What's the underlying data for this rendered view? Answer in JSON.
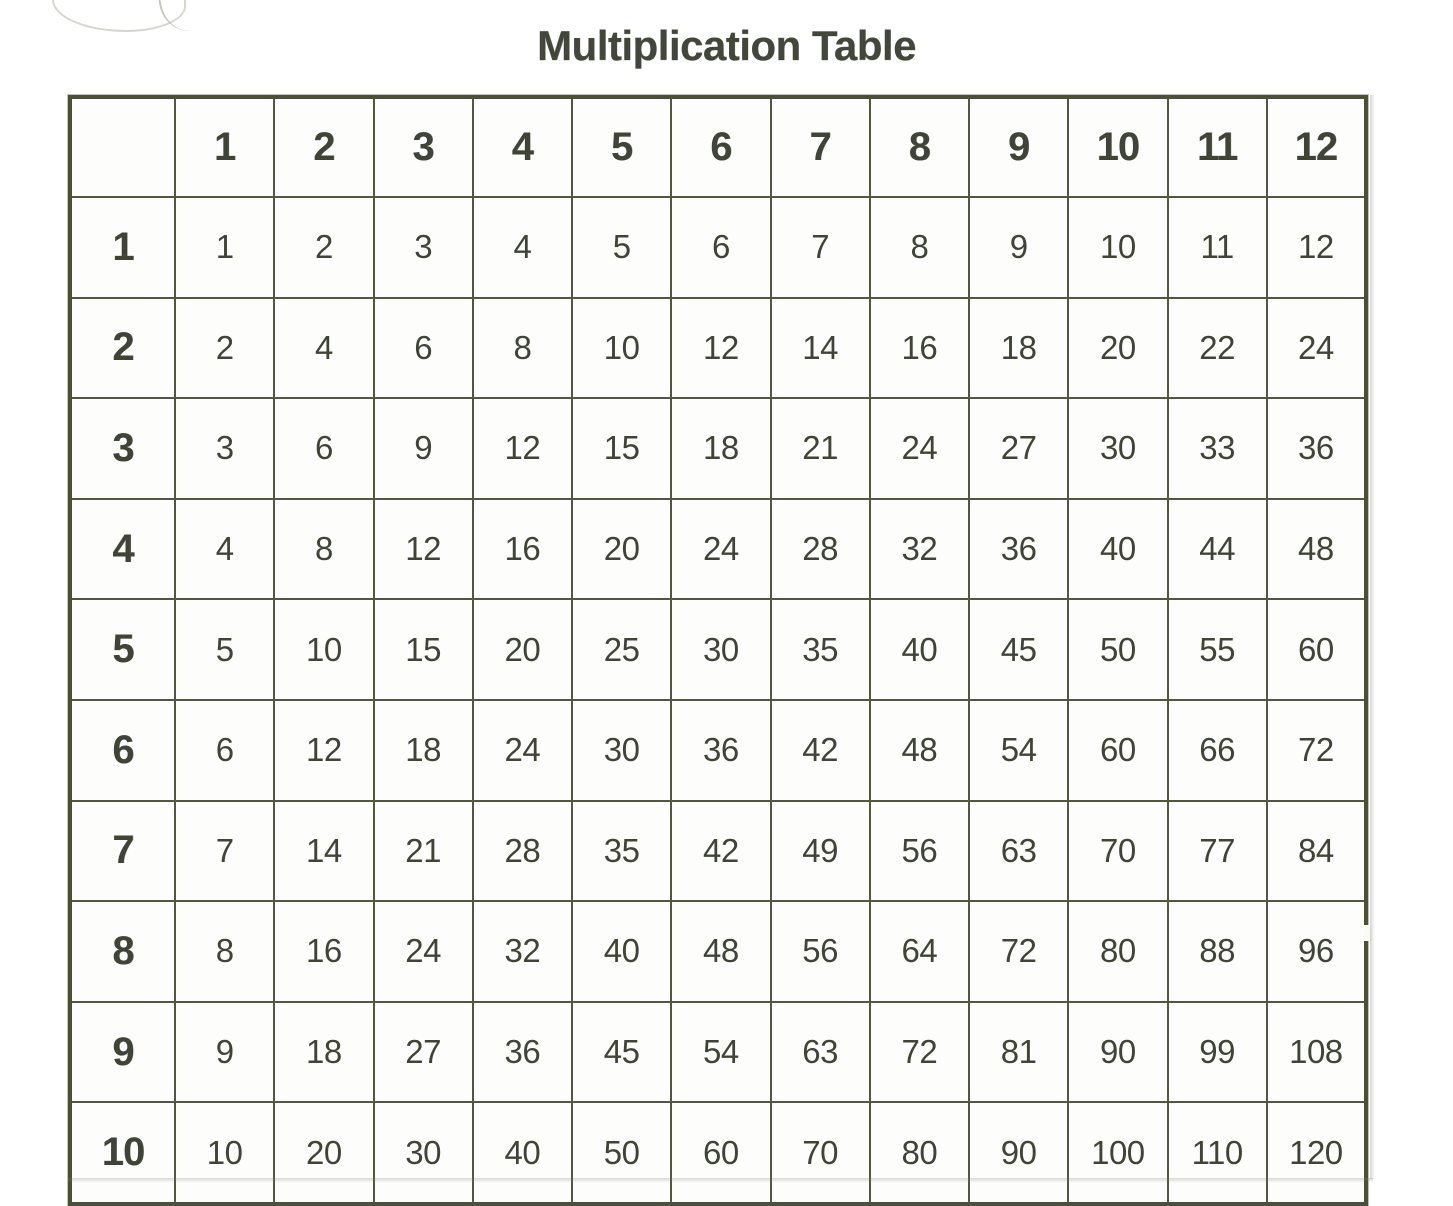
{
  "document": {
    "title": "Multiplication Table"
  },
  "table": {
    "corner_label": "",
    "column_headers": [
      "1",
      "2",
      "3",
      "4",
      "5",
      "6",
      "7",
      "8",
      "9",
      "10",
      "11",
      "12"
    ],
    "row_headers": [
      "1",
      "2",
      "3",
      "4",
      "5",
      "6",
      "7",
      "8",
      "9",
      "10"
    ],
    "rows": [
      [
        "1",
        "2",
        "3",
        "4",
        "5",
        "6",
        "7",
        "8",
        "9",
        "10",
        "11",
        "12"
      ],
      [
        "2",
        "4",
        "6",
        "8",
        "10",
        "12",
        "14",
        "16",
        "18",
        "20",
        "22",
        "24"
      ],
      [
        "3",
        "6",
        "9",
        "12",
        "15",
        "18",
        "21",
        "24",
        "27",
        "30",
        "33",
        "36"
      ],
      [
        "4",
        "8",
        "12",
        "16",
        "20",
        "24",
        "28",
        "32",
        "36",
        "40",
        "44",
        "48"
      ],
      [
        "5",
        "10",
        "15",
        "20",
        "25",
        "30",
        "35",
        "40",
        "45",
        "50",
        "55",
        "60"
      ],
      [
        "6",
        "12",
        "18",
        "24",
        "30",
        "36",
        "42",
        "48",
        "54",
        "60",
        "66",
        "72"
      ],
      [
        "7",
        "14",
        "21",
        "28",
        "35",
        "42",
        "49",
        "56",
        "63",
        "70",
        "77",
        "84"
      ],
      [
        "8",
        "16",
        "24",
        "32",
        "40",
        "48",
        "56",
        "64",
        "72",
        "80",
        "88",
        "96"
      ],
      [
        "9",
        "18",
        "27",
        "36",
        "45",
        "54",
        "63",
        "72",
        "81",
        "90",
        "99",
        "108"
      ],
      [
        "10",
        "20",
        "30",
        "40",
        "50",
        "60",
        "70",
        "80",
        "90",
        "100",
        "110",
        "120"
      ]
    ]
  },
  "chart_data": {
    "type": "table",
    "title": "Multiplication Table",
    "xlabel": "",
    "ylabel": "",
    "categories": [
      "1",
      "2",
      "3",
      "4",
      "5",
      "6",
      "7",
      "8",
      "9",
      "10",
      "11",
      "12"
    ],
    "row_categories": [
      "1",
      "2",
      "3",
      "4",
      "5",
      "6",
      "7",
      "8",
      "9",
      "10"
    ],
    "values": [
      [
        1,
        2,
        3,
        4,
        5,
        6,
        7,
        8,
        9,
        10,
        11,
        12
      ],
      [
        2,
        4,
        6,
        8,
        10,
        12,
        14,
        16,
        18,
        20,
        22,
        24
      ],
      [
        3,
        6,
        9,
        12,
        15,
        18,
        21,
        24,
        27,
        30,
        33,
        36
      ],
      [
        4,
        8,
        12,
        16,
        20,
        24,
        28,
        32,
        36,
        40,
        44,
        48
      ],
      [
        5,
        10,
        15,
        20,
        25,
        30,
        35,
        40,
        45,
        50,
        55,
        60
      ],
      [
        6,
        12,
        18,
        24,
        30,
        36,
        42,
        48,
        54,
        60,
        66,
        72
      ],
      [
        7,
        14,
        21,
        28,
        35,
        42,
        49,
        56,
        63,
        70,
        77,
        84
      ],
      [
        8,
        16,
        24,
        32,
        40,
        48,
        56,
        64,
        72,
        80,
        88,
        96
      ],
      [
        9,
        18,
        27,
        36,
        45,
        54,
        63,
        72,
        81,
        90,
        99,
        108
      ],
      [
        10,
        20,
        30,
        40,
        50,
        60,
        70,
        80,
        90,
        100,
        110,
        120
      ]
    ]
  },
  "colors": {
    "ink": "#3f4436",
    "grid": "#52573f",
    "frame": "#4b5038",
    "paper": "#fdfdfb"
  }
}
